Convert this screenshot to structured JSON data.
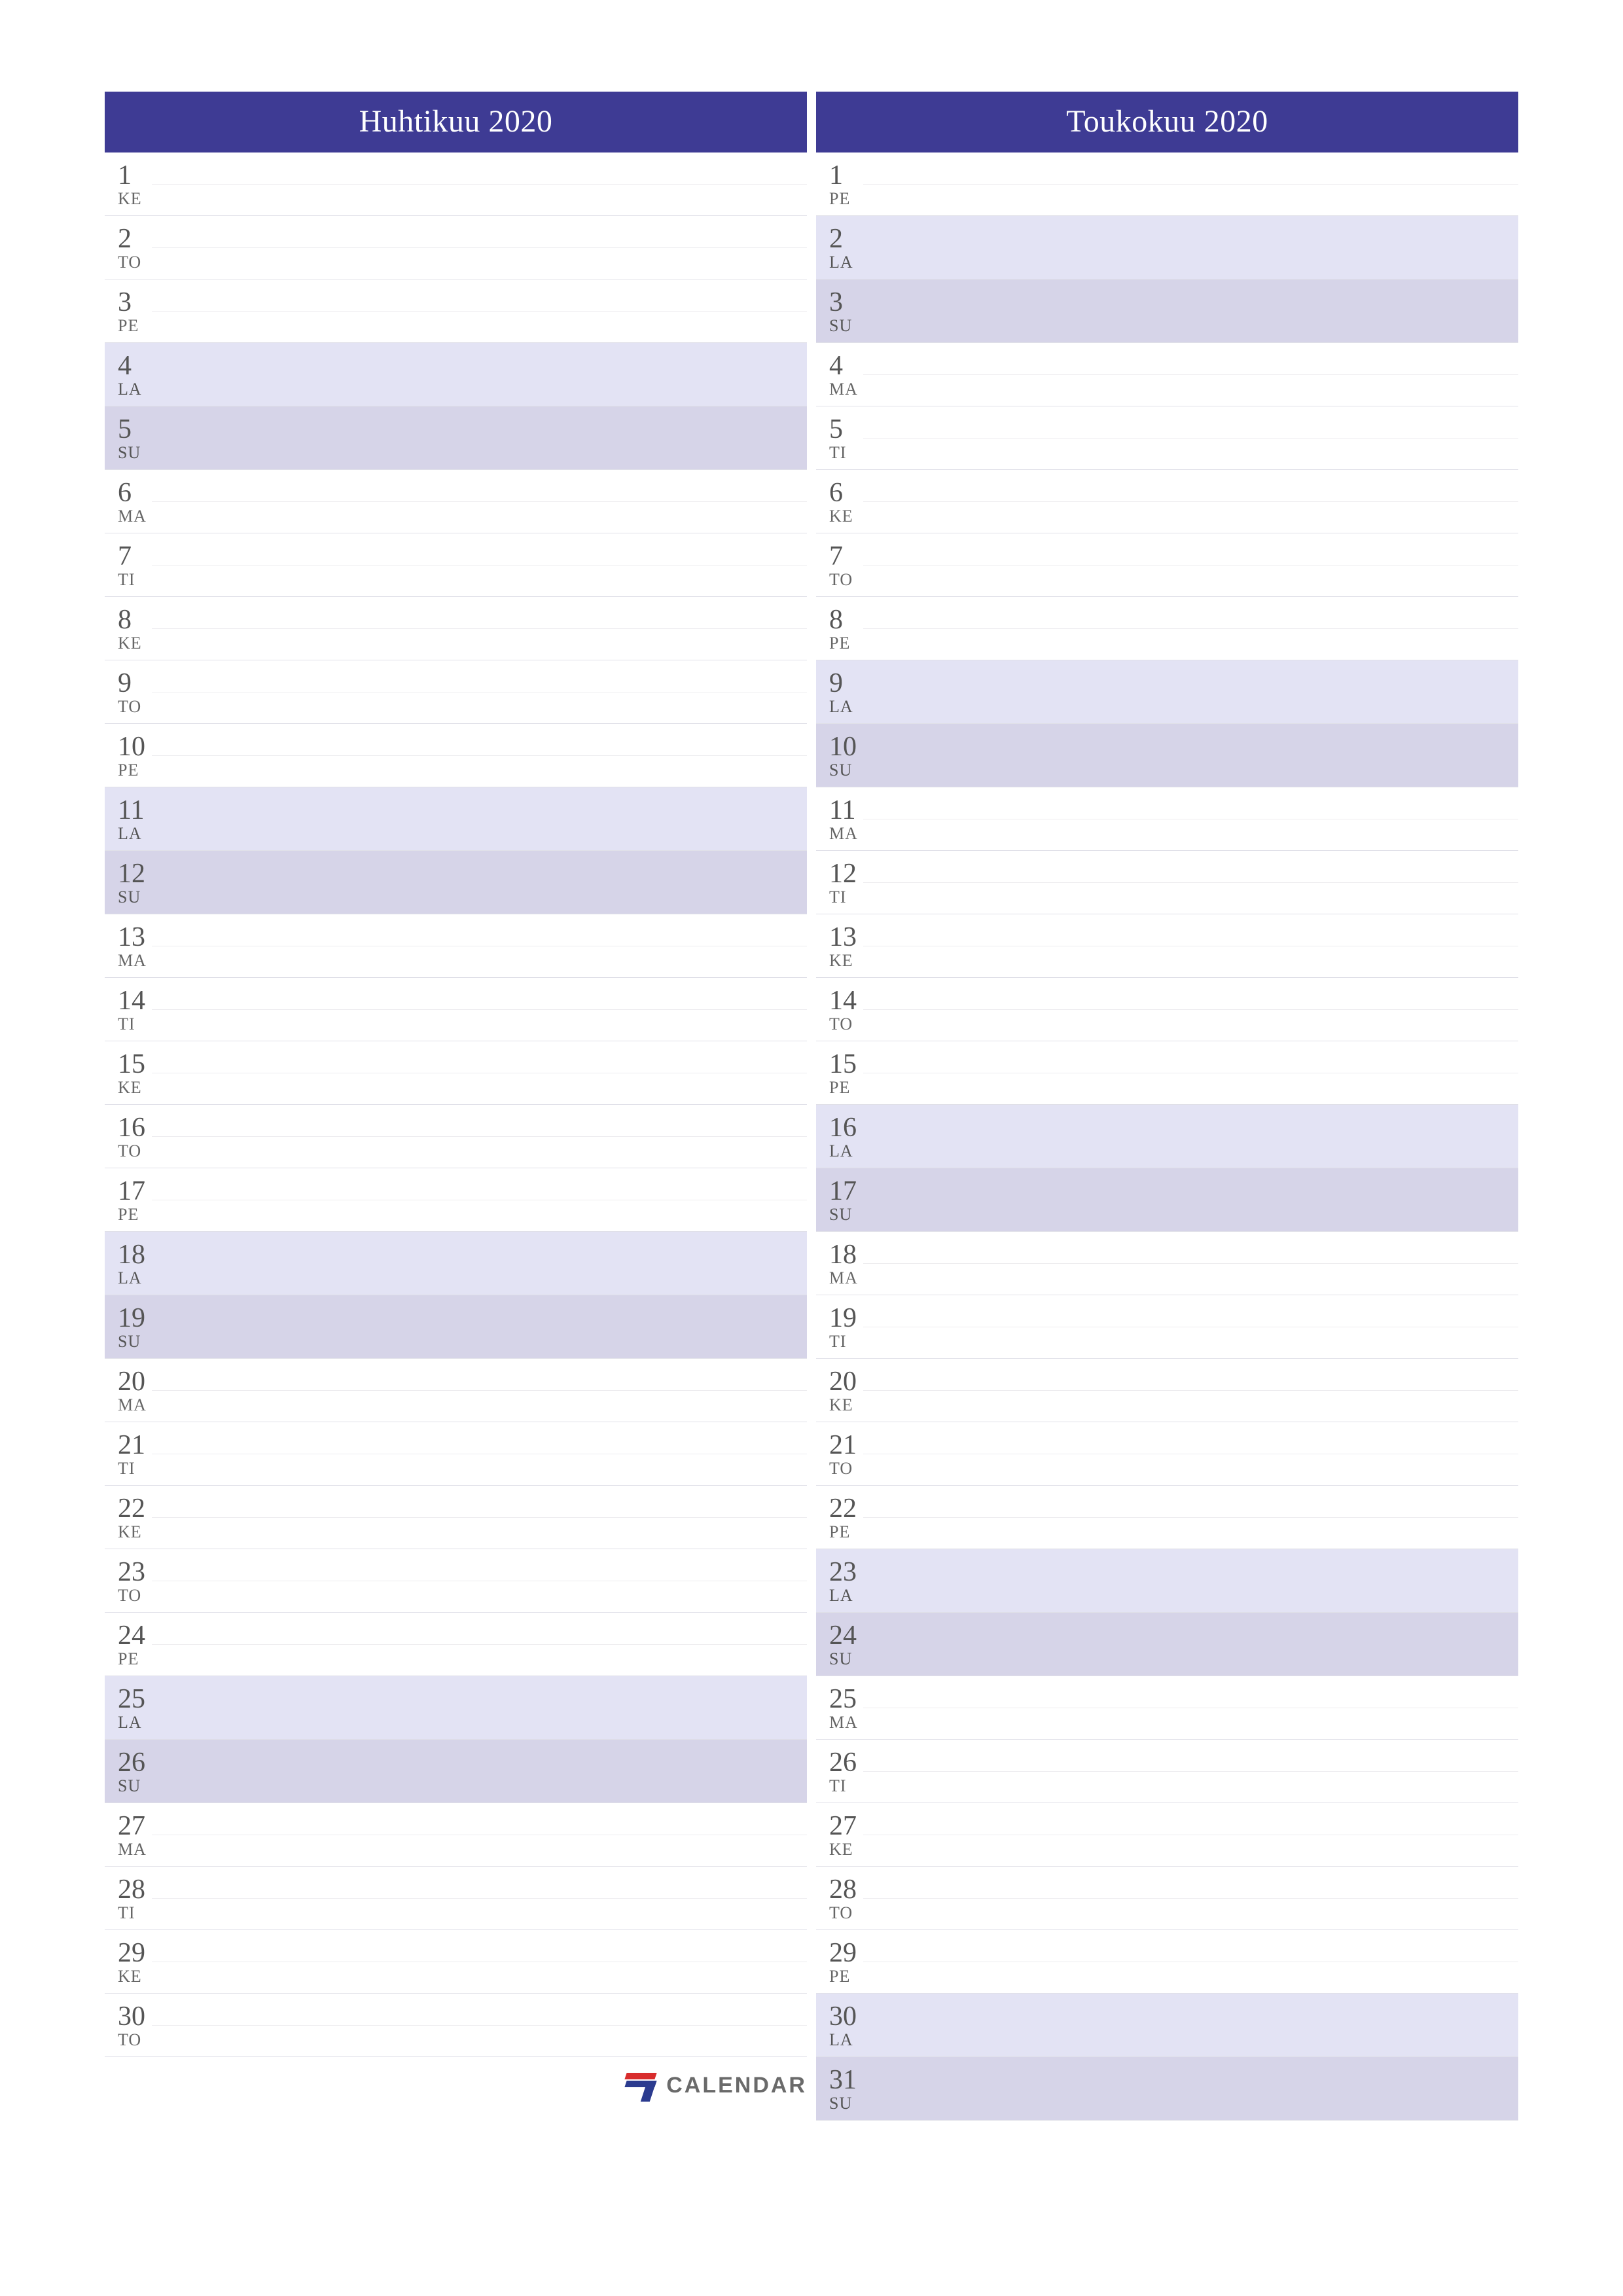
{
  "brand": "CALENDAR",
  "colors": {
    "header_bg": "#3e3b94",
    "sat_bg": "#e3e3f4",
    "sun_bg": "#d6d4e8"
  },
  "months": [
    {
      "title": "Huhtikuu 2020",
      "days": [
        {
          "n": "1",
          "w": "KE",
          "t": "wd"
        },
        {
          "n": "2",
          "w": "TO",
          "t": "wd"
        },
        {
          "n": "3",
          "w": "PE",
          "t": "wd"
        },
        {
          "n": "4",
          "w": "LA",
          "t": "sat"
        },
        {
          "n": "5",
          "w": "SU",
          "t": "sun"
        },
        {
          "n": "6",
          "w": "MA",
          "t": "wd"
        },
        {
          "n": "7",
          "w": "TI",
          "t": "wd"
        },
        {
          "n": "8",
          "w": "KE",
          "t": "wd"
        },
        {
          "n": "9",
          "w": "TO",
          "t": "wd"
        },
        {
          "n": "10",
          "w": "PE",
          "t": "wd"
        },
        {
          "n": "11",
          "w": "LA",
          "t": "sat"
        },
        {
          "n": "12",
          "w": "SU",
          "t": "sun"
        },
        {
          "n": "13",
          "w": "MA",
          "t": "wd"
        },
        {
          "n": "14",
          "w": "TI",
          "t": "wd"
        },
        {
          "n": "15",
          "w": "KE",
          "t": "wd"
        },
        {
          "n": "16",
          "w": "TO",
          "t": "wd"
        },
        {
          "n": "17",
          "w": "PE",
          "t": "wd"
        },
        {
          "n": "18",
          "w": "LA",
          "t": "sat"
        },
        {
          "n": "19",
          "w": "SU",
          "t": "sun"
        },
        {
          "n": "20",
          "w": "MA",
          "t": "wd"
        },
        {
          "n": "21",
          "w": "TI",
          "t": "wd"
        },
        {
          "n": "22",
          "w": "KE",
          "t": "wd"
        },
        {
          "n": "23",
          "w": "TO",
          "t": "wd"
        },
        {
          "n": "24",
          "w": "PE",
          "t": "wd"
        },
        {
          "n": "25",
          "w": "LA",
          "t": "sat"
        },
        {
          "n": "26",
          "w": "SU",
          "t": "sun"
        },
        {
          "n": "27",
          "w": "MA",
          "t": "wd"
        },
        {
          "n": "28",
          "w": "TI",
          "t": "wd"
        },
        {
          "n": "29",
          "w": "KE",
          "t": "wd"
        },
        {
          "n": "30",
          "w": "TO",
          "t": "wd"
        }
      ]
    },
    {
      "title": "Toukokuu 2020",
      "days": [
        {
          "n": "1",
          "w": "PE",
          "t": "wd"
        },
        {
          "n": "2",
          "w": "LA",
          "t": "sat"
        },
        {
          "n": "3",
          "w": "SU",
          "t": "sun"
        },
        {
          "n": "4",
          "w": "MA",
          "t": "wd"
        },
        {
          "n": "5",
          "w": "TI",
          "t": "wd"
        },
        {
          "n": "6",
          "w": "KE",
          "t": "wd"
        },
        {
          "n": "7",
          "w": "TO",
          "t": "wd"
        },
        {
          "n": "8",
          "w": "PE",
          "t": "wd"
        },
        {
          "n": "9",
          "w": "LA",
          "t": "sat"
        },
        {
          "n": "10",
          "w": "SU",
          "t": "sun"
        },
        {
          "n": "11",
          "w": "MA",
          "t": "wd"
        },
        {
          "n": "12",
          "w": "TI",
          "t": "wd"
        },
        {
          "n": "13",
          "w": "KE",
          "t": "wd"
        },
        {
          "n": "14",
          "w": "TO",
          "t": "wd"
        },
        {
          "n": "15",
          "w": "PE",
          "t": "wd"
        },
        {
          "n": "16",
          "w": "LA",
          "t": "sat"
        },
        {
          "n": "17",
          "w": "SU",
          "t": "sun"
        },
        {
          "n": "18",
          "w": "MA",
          "t": "wd"
        },
        {
          "n": "19",
          "w": "TI",
          "t": "wd"
        },
        {
          "n": "20",
          "w": "KE",
          "t": "wd"
        },
        {
          "n": "21",
          "w": "TO",
          "t": "wd"
        },
        {
          "n": "22",
          "w": "PE",
          "t": "wd"
        },
        {
          "n": "23",
          "w": "LA",
          "t": "sat"
        },
        {
          "n": "24",
          "w": "SU",
          "t": "sun"
        },
        {
          "n": "25",
          "w": "MA",
          "t": "wd"
        },
        {
          "n": "26",
          "w": "TI",
          "t": "wd"
        },
        {
          "n": "27",
          "w": "KE",
          "t": "wd"
        },
        {
          "n": "28",
          "w": "TO",
          "t": "wd"
        },
        {
          "n": "29",
          "w": "PE",
          "t": "wd"
        },
        {
          "n": "30",
          "w": "LA",
          "t": "sat"
        },
        {
          "n": "31",
          "w": "SU",
          "t": "sun"
        }
      ]
    }
  ]
}
